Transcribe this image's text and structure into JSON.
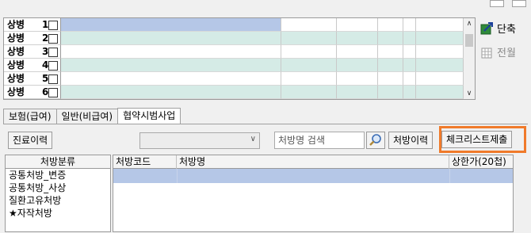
{
  "diagnosis": {
    "rows": [
      {
        "label": "상병",
        "num": "1"
      },
      {
        "label": "상병",
        "num": "2"
      },
      {
        "label": "상병",
        "num": "3"
      },
      {
        "label": "상병",
        "num": "4"
      },
      {
        "label": "상병",
        "num": "5"
      },
      {
        "label": "상병",
        "num": "6"
      }
    ]
  },
  "side": {
    "shortcut_label": "단축",
    "all_month_label": "전월"
  },
  "tabs": [
    {
      "label": "보험(급여)",
      "active": false
    },
    {
      "label": "일반(비급여)",
      "active": false
    },
    {
      "label": "협약시범사업",
      "active": true
    }
  ],
  "toolbar": {
    "history_button": "진료이력",
    "combo_value": "",
    "search_placeholder": "처방명 검색",
    "rx_history_button": "처방이력",
    "checklist_button": "체크리스트제출"
  },
  "category": {
    "header": "처방분류",
    "items": [
      "공통처방_변증",
      "공통처방_사상",
      "질환고유처방",
      "★자작처방"
    ]
  },
  "prescriptions": {
    "columns": [
      "처방코드",
      "처방명",
      "상한가(20첩)"
    ],
    "rows": []
  },
  "colors": {
    "row_alt": "#d5ebe6",
    "row_selected": "#b5c7e7",
    "highlight": "#f07a2a"
  }
}
